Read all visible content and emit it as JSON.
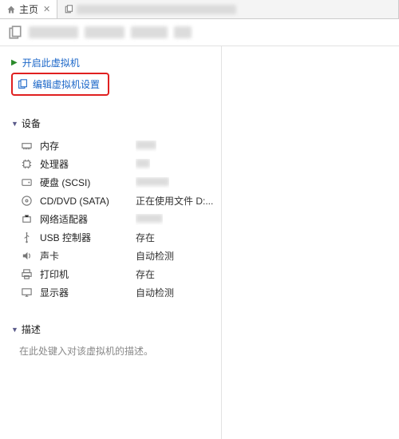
{
  "tabs": {
    "home_label": "主页",
    "second_tab_label": "████████████"
  },
  "title": "██████ ████ ████ ██",
  "actions": {
    "power_on_label": "开启此虚拟机",
    "edit_settings_label": "编辑虚拟机设置"
  },
  "sections": {
    "devices_title": "设备",
    "description_title": "描述"
  },
  "devices": [
    {
      "icon": "memory-icon",
      "name": "内存",
      "value": "██"
    },
    {
      "icon": "cpu-icon",
      "name": "处理器",
      "value": "█"
    },
    {
      "icon": "hdd-icon",
      "name": "硬盘 (SCSI)",
      "value": "████"
    },
    {
      "icon": "disc-icon",
      "name": "CD/DVD (SATA)",
      "value": "正在使用文件 D:..."
    },
    {
      "icon": "network-icon",
      "name": "网络适配器",
      "value": "███"
    },
    {
      "icon": "usb-icon",
      "name": "USB 控制器",
      "value": "存在"
    },
    {
      "icon": "sound-icon",
      "name": "声卡",
      "value": "自动检测"
    },
    {
      "icon": "printer-icon",
      "name": "打印机",
      "value": "存在"
    },
    {
      "icon": "display-icon",
      "name": "显示器",
      "value": "自动检测"
    }
  ],
  "description_placeholder": "在此处键入对该虚拟机的描述。"
}
